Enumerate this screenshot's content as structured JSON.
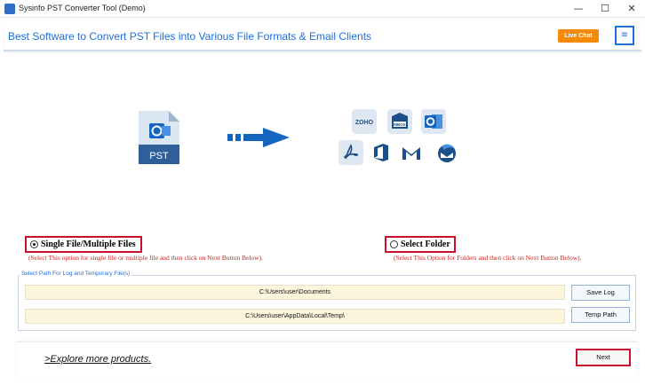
{
  "window": {
    "title": "Sysinfo PST Converter Tool (Demo)",
    "minimize": "—",
    "maximize": "☐",
    "close": "✕"
  },
  "header": {
    "title": "Best Software to Convert PST Files into Various File Formats & Email Clients",
    "live_chat": "Live Chat",
    "menu_icon": "≡"
  },
  "hero": {
    "source_label": "PST",
    "source_icon": "pst-file-icon",
    "arrow_icon": "dashed-arrow-icon",
    "targets": [
      {
        "name": "zoho-icon",
        "text": "ZOHO"
      },
      {
        "name": "mbox-icon",
        "text": "MBOX"
      },
      {
        "name": "outlook-icon",
        "text": ""
      },
      {
        "name": "pdf-icon",
        "text": ""
      },
      {
        "name": "office365-icon",
        "text": ""
      },
      {
        "name": "gmail-icon",
        "text": ""
      },
      {
        "name": "thunderbird-icon",
        "text": ""
      }
    ]
  },
  "options": {
    "single": {
      "label": "Single File/Multiple Files",
      "hint": "(Select This option for single file or multiple file and then click on Next Button Below).",
      "checked": true
    },
    "folder": {
      "label": "Select Folder",
      "hint": "(Select This Option for Folders and then click on Next Button Below).",
      "checked": false
    }
  },
  "paths": {
    "legend": "Select Path For Log and Temporary File(s)",
    "log_path": "C:\\Users\\user\\Documents",
    "temp_path": "C:\\Users\\user\\AppData\\Local\\Temp\\",
    "save_log_label": "Save Log",
    "temp_path_label": "Temp Path"
  },
  "footer": {
    "explore": ">Explore more products.",
    "next": "Next"
  },
  "colors": {
    "accent": "#1e6fd9",
    "live_chat": "#f58a0a",
    "highlight_border": "#c8102e",
    "hint_text": "#d02020",
    "path_field": "#fdf6dd"
  }
}
